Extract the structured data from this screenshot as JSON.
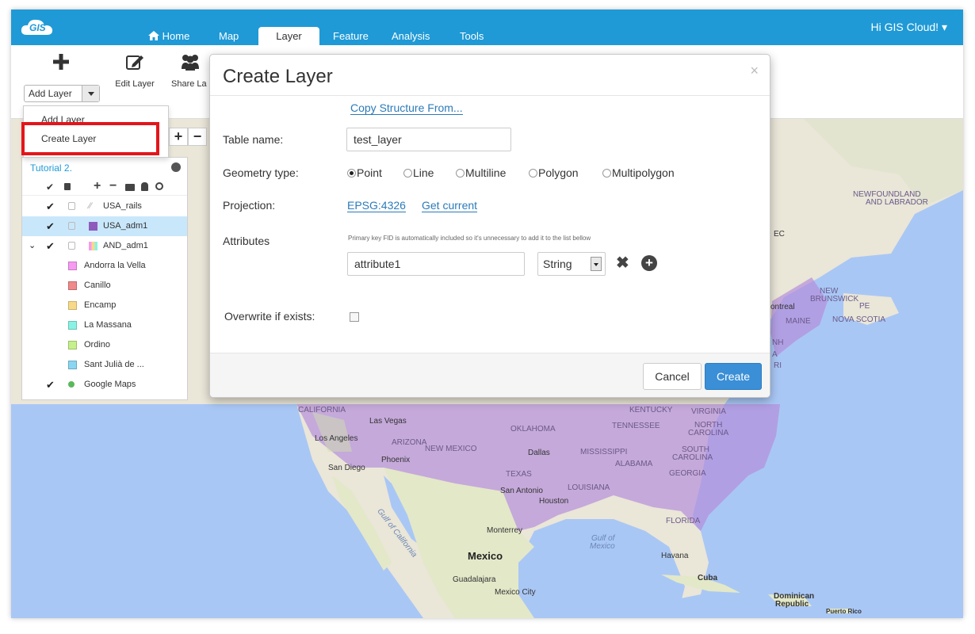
{
  "nav": {
    "logo_text": "GIS",
    "items": [
      {
        "label": "Home",
        "icon": "home-icon"
      },
      {
        "label": "Map"
      },
      {
        "label": "Layer",
        "active": true
      },
      {
        "label": "Feature"
      },
      {
        "label": "Analysis"
      },
      {
        "label": "Tools"
      }
    ],
    "user": "Hi GIS Cloud! ▾"
  },
  "toolbar": {
    "add_layer_select": "Add Layer",
    "edit_layer": "Edit Layer",
    "share_layer": "Share La"
  },
  "dropdown": {
    "items": [
      "Add Layer",
      "Create Layer"
    ]
  },
  "layer_panel": {
    "title": "Tutorial 2.",
    "rows": [
      {
        "name": "USA_rails"
      },
      {
        "name": "USA_adm1",
        "selected": true,
        "color": "#8e5bbd"
      },
      {
        "name": "AND_adm1"
      },
      {
        "name": "Andorra la Vella",
        "color": "#f59bf0"
      },
      {
        "name": "Canillo",
        "color": "#f08a8a"
      },
      {
        "name": "Encamp",
        "color": "#f7d98a"
      },
      {
        "name": "La Massana",
        "color": "#8af2e4"
      },
      {
        "name": "Ordino",
        "color": "#c6f08a"
      },
      {
        "name": "Sant Julià de ...",
        "color": "#8ad6f2"
      },
      {
        "name": "Google Maps"
      }
    ]
  },
  "modal": {
    "title": "Create Layer",
    "close": "×",
    "copy_structure_link": "Copy Structure From...",
    "table_name_label": "Table name:",
    "table_name_value": "test_layer",
    "geometry_label": "Geometry type:",
    "geometry_options": [
      "Point",
      "Line",
      "Multiline",
      "Polygon",
      "Multipolygon"
    ],
    "geometry_selected": "Point",
    "projection_label": "Projection:",
    "projection_value": "EPSG:4326",
    "get_current_link": "Get current",
    "attributes_label": "Attributes",
    "attributes_hint": "Primary key FID is automatically included so it's unnecessary to add it to the list bellow",
    "attribute_name": "attribute1",
    "attribute_type": "String",
    "overwrite_label": "Overwrite if exists:",
    "cancel": "Cancel",
    "create": "Create"
  },
  "map_labels": {
    "newfoundland": "NEWFOUNDLAND",
    "labrador": "AND LABRADOR",
    "new": "NEW",
    "brunswick": "BRUNSWICK",
    "pe": "PE",
    "nova_scotia": "NOVA SCOTIA",
    "maine": "MAINE",
    "montreal": "ontreal",
    "ec": "EC",
    "nh": "NH",
    "a": "A",
    "ri": "RI",
    "california": "CALIFORNIA",
    "las_vegas": "Las Vegas",
    "los_angeles": "Los Angeles",
    "arizona": "ARIZONA",
    "phoenix": "Phoenix",
    "san_diego": "San Diego",
    "new_mexico": "NEW MEXICO",
    "oklahoma": "OKLAHOMA",
    "dallas": "Dallas",
    "texas": "TEXAS",
    "san_antonio": "San Antonio",
    "houston": "Houston",
    "louisiana": "LOUISIANA",
    "mississippi": "MISSISSIPPI",
    "alabama": "ALABAMA",
    "georgia": "GEORGIA",
    "tennessee": "TENNESSEE",
    "kentucky": "KENTUCKY",
    "virginia": "VIRGINIA",
    "north": "NORTH",
    "carolina_n": "CAROLINA",
    "south": "SOUTH",
    "carolina_s": "CAROLINA",
    "florida": "FLORIDA",
    "gulf_of_california": "Gulf of California",
    "monterrey": "Monterrey",
    "mexico": "Mexico",
    "gulf_of": "Gulf of",
    "mexico_water": "Mexico",
    "havana": "Havana",
    "cuba": "Cuba",
    "guadalajara": "Guadalajara",
    "mexico_city": "Mexico City",
    "dominican": "Dominican",
    "republic": "Republic",
    "puerto_rico": "Puerto Rico"
  }
}
